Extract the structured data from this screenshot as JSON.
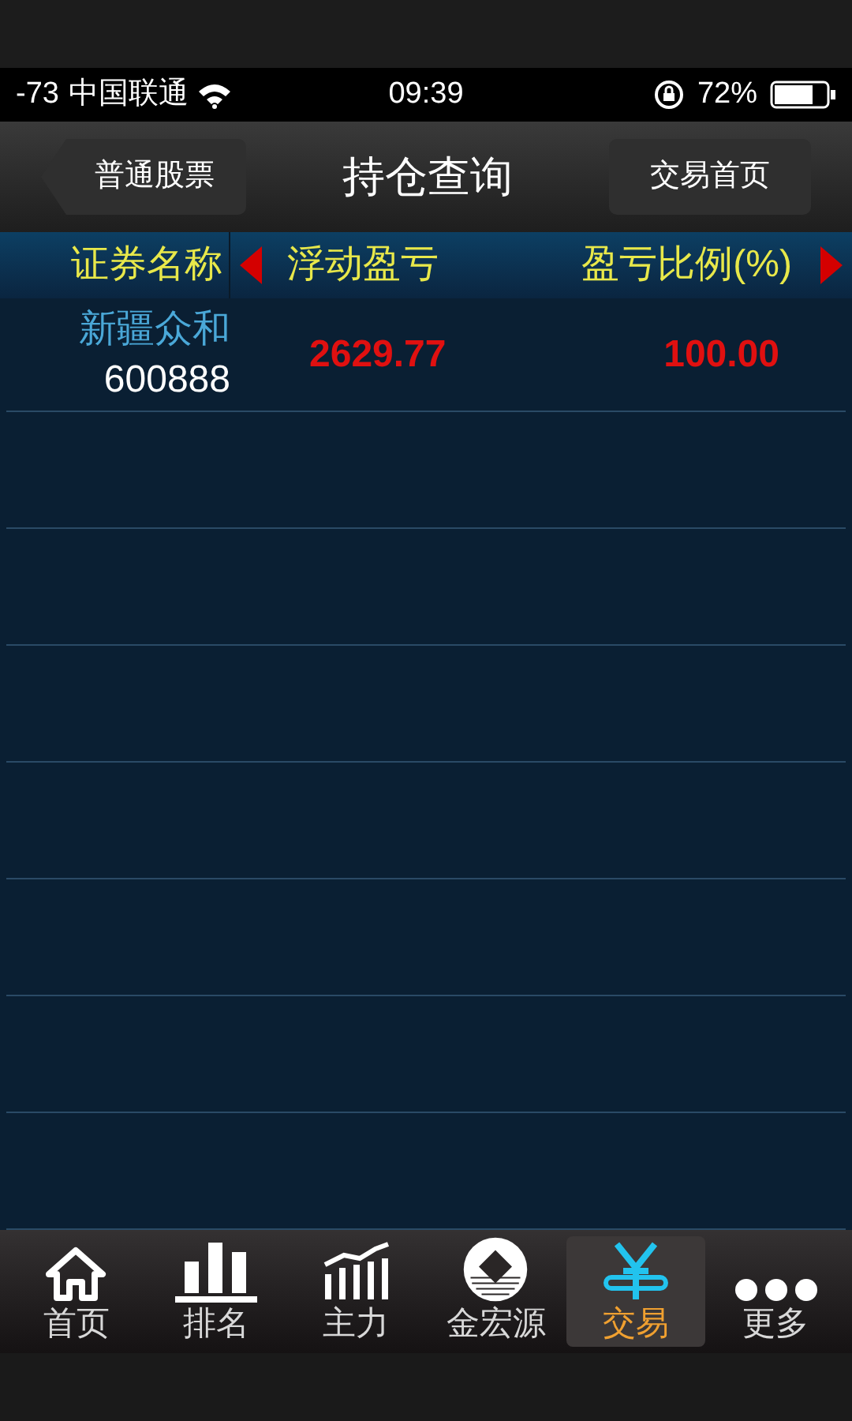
{
  "status_bar": {
    "signal": "-73",
    "carrier": "中国联通",
    "time": "09:39",
    "battery": "72%"
  },
  "nav": {
    "back": "普通股票",
    "title": "持仓查询",
    "action": "交易首页"
  },
  "table": {
    "columns": [
      "证券名称",
      "浮动盈亏",
      "盈亏比例(%)"
    ],
    "rows": [
      {
        "name": "新疆众和",
        "code": "600888",
        "profit": "2629.77",
        "ratio": "100.00"
      }
    ]
  },
  "tab_bar": [
    {
      "label": "首页",
      "selected": false
    },
    {
      "label": "排名",
      "selected": false
    },
    {
      "label": "主力",
      "selected": false
    },
    {
      "label": "金宏源",
      "selected": false
    },
    {
      "label": "交易",
      "selected": true
    },
    {
      "label": "更多",
      "selected": false
    }
  ]
}
